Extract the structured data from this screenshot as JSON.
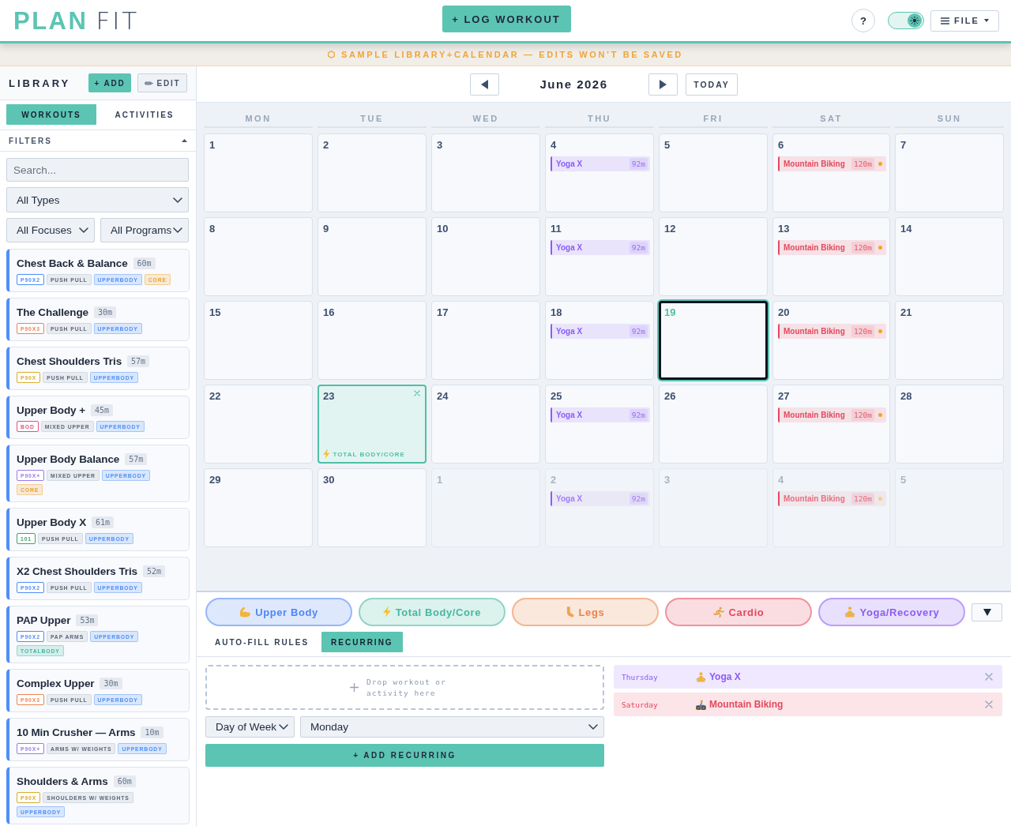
{
  "header": {
    "logo": {
      "primary": "PLAN",
      "secondary": "FIT"
    },
    "log_button": "+ LOG WORKOUT",
    "help_button": "?",
    "theme_toggle": {
      "on": true
    },
    "file_menu": "FILE"
  },
  "banner": {
    "text": "SAMPLE LIBRARY+CALENDAR — EDITS WON’T BE SAVED"
  },
  "sidebar": {
    "title": "LIBRARY",
    "add_button": "+ ADD",
    "edit_button": "EDIT",
    "tabs": [
      {
        "label": "WORKOUTS",
        "selected": true
      },
      {
        "label": "ACTIVITIES",
        "selected": false
      }
    ],
    "filters": {
      "title": "FILTERS",
      "expanded": true,
      "search": {
        "placeholder": "Search..."
      },
      "type": "All Types",
      "focus": "All Focuses",
      "program": "All Programs"
    },
    "workouts": [
      {
        "title": "Chest Back & Balance",
        "duration": "60m",
        "tags": [
          {
            "label": "P90X2",
            "kind": "program",
            "color": "#4f8ef7"
          },
          {
            "label": "PUSH PULL",
            "kind": "focus",
            "color": "#5b6474"
          },
          {
            "label": "UPPERBODY",
            "kind": "type",
            "color": "#4f8ef7"
          },
          {
            "label": "CORE",
            "kind": "type",
            "color": "#ee9f2c"
          }
        ]
      },
      {
        "title": "The Challenge",
        "duration": "30m",
        "tags": [
          {
            "label": "P90X3",
            "kind": "program",
            "color": "#f0844f"
          },
          {
            "label": "PUSH PULL",
            "kind": "focus",
            "color": "#5b6474"
          },
          {
            "label": "UPPERBODY",
            "kind": "type",
            "color": "#4f8ef7"
          }
        ]
      },
      {
        "title": "Chest Shoulders Tris",
        "duration": "57m",
        "tags": [
          {
            "label": "P90X",
            "kind": "program",
            "color": "#d9ad2b"
          },
          {
            "label": "PUSH PULL",
            "kind": "focus",
            "color": "#5b6474"
          },
          {
            "label": "UPPERBODY",
            "kind": "type",
            "color": "#4f8ef7"
          }
        ]
      },
      {
        "title": "Upper Body +",
        "duration": "45m",
        "tags": [
          {
            "label": "BOD",
            "kind": "program",
            "color": "#e0557a"
          },
          {
            "label": "MIXED UPPER",
            "kind": "focus",
            "color": "#5b6474"
          },
          {
            "label": "UPPERBODY",
            "kind": "type",
            "color": "#4f8ef7"
          }
        ]
      },
      {
        "title": "Upper Body Balance",
        "duration": "57m",
        "tags": [
          {
            "label": "P90X+",
            "kind": "program",
            "color": "#9b7be8"
          },
          {
            "label": "MIXED UPPER",
            "kind": "focus",
            "color": "#5b6474"
          },
          {
            "label": "UPPERBODY",
            "kind": "type",
            "color": "#4f8ef7"
          },
          {
            "label": "CORE",
            "kind": "type",
            "color": "#ee9f2c"
          }
        ]
      },
      {
        "title": "Upper Body X",
        "duration": "61m",
        "tags": [
          {
            "label": "101",
            "kind": "program",
            "color": "#3fa464"
          },
          {
            "label": "PUSH PULL",
            "kind": "focus",
            "color": "#5b6474"
          },
          {
            "label": "UPPERBODY",
            "kind": "type",
            "color": "#4f8ef7"
          }
        ]
      },
      {
        "title": "X2 Chest Shoulders Tris",
        "duration": "52m",
        "tags": [
          {
            "label": "P90X2",
            "kind": "program",
            "color": "#4f8ef7"
          },
          {
            "label": "PUSH PULL",
            "kind": "focus",
            "color": "#5b6474"
          },
          {
            "label": "UPPERBODY",
            "kind": "type",
            "color": "#4f8ef7"
          }
        ]
      },
      {
        "title": "PAP Upper",
        "duration": "53m",
        "tags": [
          {
            "label": "P90X2",
            "kind": "program",
            "color": "#4f8ef7"
          },
          {
            "label": "PAP ARMS",
            "kind": "focus",
            "color": "#5b6474"
          },
          {
            "label": "UPPERBODY",
            "kind": "type",
            "color": "#4f8ef7"
          },
          {
            "label": "TOTALBODY",
            "kind": "type",
            "color": "#3fb89f"
          }
        ]
      },
      {
        "title": "Complex Upper",
        "duration": "30m",
        "tags": [
          {
            "label": "P90X3",
            "kind": "program",
            "color": "#f0844f"
          },
          {
            "label": "PUSH PULL",
            "kind": "focus",
            "color": "#5b6474"
          },
          {
            "label": "UPPERBODY",
            "kind": "type",
            "color": "#4f8ef7"
          }
        ]
      },
      {
        "title": "10 Min Crusher — Arms",
        "duration": "10m",
        "tags": [
          {
            "label": "P90X+",
            "kind": "program",
            "color": "#9b7be8"
          },
          {
            "label": "ARMS W/ WEIGHTS",
            "kind": "focus",
            "color": "#5b6474"
          },
          {
            "label": "UPPERBODY",
            "kind": "type",
            "color": "#4f8ef7"
          }
        ]
      },
      {
        "title": "Shoulders & Arms",
        "duration": "60m",
        "tags": [
          {
            "label": "P90X",
            "kind": "program",
            "color": "#d9ad2b"
          },
          {
            "label": "SHOULDERS W/ WEIGHTS",
            "kind": "focus",
            "color": "#5b6474"
          },
          {
            "label": "UPPERBODY",
            "kind": "type",
            "color": "#4f8ef7"
          }
        ]
      }
    ]
  },
  "calendar": {
    "month": "June 2026",
    "today_button": "TODAY",
    "weekdays": [
      "MON",
      "TUE",
      "WED",
      "THU",
      "FRI",
      "SAT",
      "SUN"
    ],
    "weeks": [
      [
        {
          "day": "1",
          "today": false,
          "outside": false
        },
        {
          "day": "2",
          "today": false,
          "outside": false
        },
        {
          "day": "3",
          "today": false,
          "outside": false
        },
        {
          "day": "4",
          "today": false,
          "outside": false,
          "events": [
            {
              "title": "Yoga X",
              "duration": "92m",
              "color": "#8b5cf6",
              "flagged": false
            }
          ]
        },
        {
          "day": "5",
          "today": false,
          "outside": false
        },
        {
          "day": "6",
          "today": false,
          "outside": false,
          "events": [
            {
              "title": "Mountain Biking",
              "duration": "120m",
              "color": "#e5485d",
              "flagged": true
            }
          ]
        },
        {
          "day": "7",
          "today": false,
          "outside": false
        }
      ],
      [
        {
          "day": "8",
          "today": false,
          "outside": false
        },
        {
          "day": "9",
          "today": false,
          "outside": false
        },
        {
          "day": "10",
          "today": false,
          "outside": false
        },
        {
          "day": "11",
          "today": false,
          "outside": false,
          "events": [
            {
              "title": "Yoga X",
              "duration": "92m",
              "color": "#8b5cf6",
              "flagged": false
            }
          ]
        },
        {
          "day": "12",
          "today": false,
          "outside": false
        },
        {
          "day": "13",
          "today": false,
          "outside": false,
          "events": [
            {
              "title": "Mountain Biking",
              "duration": "120m",
              "color": "#e5485d",
              "flagged": true
            }
          ]
        },
        {
          "day": "14",
          "today": false,
          "outside": false
        }
      ],
      [
        {
          "day": "15",
          "today": false,
          "outside": false
        },
        {
          "day": "16",
          "today": false,
          "outside": false
        },
        {
          "day": "17",
          "today": false,
          "outside": false
        },
        {
          "day": "18",
          "today": false,
          "outside": false,
          "events": [
            {
              "title": "Yoga X",
              "duration": "92m",
              "color": "#8b5cf6",
              "flagged": false
            }
          ]
        },
        {
          "day": "19",
          "today": true,
          "outside": false
        },
        {
          "day": "20",
          "today": false,
          "outside": false,
          "events": [
            {
              "title": "Mountain Biking",
              "duration": "120m",
              "color": "#e5485d",
              "flagged": true
            }
          ]
        },
        {
          "day": "21",
          "today": false,
          "outside": false
        }
      ],
      [
        {
          "day": "22",
          "today": false,
          "outside": false
        },
        {
          "day": "23",
          "today": false,
          "outside": false,
          "plan": {
            "label": "TOTAL BODY/CORE",
            "kind": "core",
            "color": "#4fbfa8"
          }
        },
        {
          "day": "24",
          "today": false,
          "outside": false
        },
        {
          "day": "25",
          "today": false,
          "outside": false,
          "events": [
            {
              "title": "Yoga X",
              "duration": "92m",
              "color": "#8b5cf6",
              "flagged": false
            }
          ]
        },
        {
          "day": "26",
          "today": false,
          "outside": false
        },
        {
          "day": "27",
          "today": false,
          "outside": false,
          "events": [
            {
              "title": "Mountain Biking",
              "duration": "120m",
              "color": "#e5485d",
              "flagged": true
            }
          ]
        },
        {
          "day": "28",
          "today": false,
          "outside": false
        }
      ],
      [
        {
          "day": "29",
          "today": false,
          "outside": false
        },
        {
          "day": "30",
          "today": false,
          "outside": false
        },
        {
          "day": "1",
          "today": false,
          "outside": true
        },
        {
          "day": "2",
          "today": false,
          "outside": true,
          "events": [
            {
              "title": "Yoga X",
              "duration": "92m",
              "color": "#8b5cf6",
              "flagged": false
            }
          ]
        },
        {
          "day": "3",
          "today": false,
          "outside": true
        },
        {
          "day": "4",
          "today": false,
          "outside": true,
          "events": [
            {
              "title": "Mountain Biking",
              "duration": "120m",
              "color": "#e5485d",
              "flagged": true
            }
          ]
        },
        {
          "day": "5",
          "today": false,
          "outside": true
        }
      ]
    ]
  },
  "categories": [
    {
      "label": "Upper Body",
      "kind": "strength",
      "color": "#4f86f7"
    },
    {
      "label": "Total Body/Core",
      "kind": "core",
      "color": "#45b8a2"
    },
    {
      "label": "Legs",
      "kind": "legs",
      "color": "#ec8446"
    },
    {
      "label": "Cardio",
      "kind": "cardio",
      "color": "#e5485d"
    },
    {
      "label": "Yoga/Recovery",
      "kind": "yoga",
      "color": "#8b5cf6"
    }
  ],
  "panel": {
    "tabs": [
      {
        "label": "AUTO-FILL RULES",
        "selected": false
      },
      {
        "label": "RECURRING",
        "selected": true
      }
    ],
    "drop_zone": "Drop workout or activity here",
    "period": "Day of Week",
    "day": "Monday",
    "add_button": "+ ADD RECURRING",
    "rules": [
      {
        "day": "Thursday",
        "title": "Yoga X",
        "kind": "yoga",
        "color": "#8b5cf6"
      },
      {
        "day": "Saturday",
        "title": "Mountain Biking",
        "kind": "biking",
        "color": "#e5485d"
      }
    ]
  }
}
